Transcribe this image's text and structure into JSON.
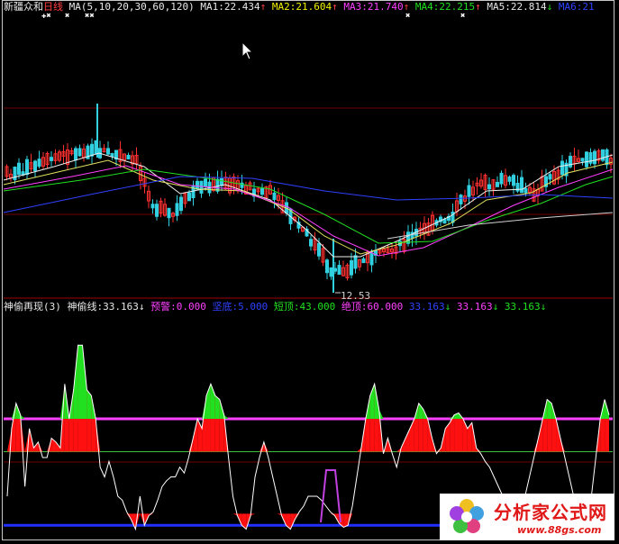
{
  "main_header": {
    "name": "新疆众和",
    "period": "日线",
    "ma_params": "MA(5,10,20,30,60,120)",
    "ma1_label": "MA1:",
    "ma1_value": "22.434",
    "ma1_arrow": "↑",
    "ma2_label": "MA2:",
    "ma2_value": "21.604",
    "ma2_arrow": "↑",
    "ma3_label": "MA3:",
    "ma3_value": "21.740",
    "ma3_arrow": "↑",
    "ma4_label": "MA4:",
    "ma4_value": "22.215",
    "ma4_arrow": "↑",
    "ma5_label": "MA5:",
    "ma5_value": "22.814",
    "ma5_arrow": "↓",
    "ma6_label": "MA6:",
    "ma6_value": "21"
  },
  "markers": [
    "✚✖",
    "✖",
    "✖✖",
    "✖",
    "✖"
  ],
  "low_price_label": "12.53",
  "indicator_header": {
    "name": "神偷再现(3)",
    "line_label": "神偷线:",
    "line_value": "33.163",
    "line_arrow": "↓",
    "warn_label": "预警:",
    "warn_value": "0.000",
    "bottom_label": "坚底:",
    "bottom_value": "5.000",
    "short_top_label": "短顶:",
    "short_top_value": "43.000",
    "abs_top_label": "绝顶:",
    "abs_top_value": "60.000",
    "extra1_value": "33.163",
    "extra1_arrow": "↓",
    "extra2_value": "33.163",
    "extra2_arrow": "↓",
    "extra3_value": "33.163",
    "extra3_arrow": "↓"
  },
  "logo": {
    "text": "分析家公式网",
    "url": "www.88gs.com"
  },
  "colors": {
    "up_candle": "#ff3030",
    "down_candle": "#30d0e0",
    "ma1": "#f0f0f0",
    "ma2": "#e0e060",
    "ma3": "#ff40ff",
    "ma4": "#20e020",
    "ma5": "#3040ff",
    "ma6": "#d0d0d0"
  },
  "chart_data": {
    "type": "line",
    "series": [
      {
        "name": "神偷线",
        "values": [
          20,
          55,
          68,
          62,
          25,
          55,
          45,
          48,
          40,
          40,
          50,
          48,
          45,
          78,
          60,
          75,
          98,
          98,
          75,
          72,
          60,
          35,
          30,
          38,
          30,
          20,
          18,
          12,
          8,
          3,
          20,
          5,
          10,
          12,
          18,
          25,
          28,
          30,
          30,
          35,
          32,
          40,
          50,
          60,
          55,
          72,
          78,
          72,
          70,
          62,
          40,
          20,
          10,
          5,
          3,
          10,
          30,
          40,
          48,
          40,
          30,
          20,
          10,
          5,
          3,
          8,
          12,
          15,
          20,
          20,
          20,
          18,
          15,
          12,
          10,
          6,
          4,
          5,
          15,
          30,
          45,
          60,
          72,
          78,
          65,
          42,
          50,
          42,
          35,
          45,
          50,
          55,
          60,
          68,
          65,
          60,
          50,
          42,
          45,
          55,
          58,
          62,
          63,
          60,
          55,
          58,
          45,
          42,
          38,
          35,
          30,
          25,
          20,
          15,
          10,
          10,
          10,
          20,
          30,
          40,
          50,
          60,
          70,
          68,
          60,
          50,
          40,
          30,
          20,
          10,
          2,
          5,
          20,
          40,
          60,
          70,
          62
        ]
      }
    ],
    "reference_lines": {
      "warn": 0,
      "bottom": 5,
      "short_top": 43,
      "abs_top": 60
    }
  }
}
